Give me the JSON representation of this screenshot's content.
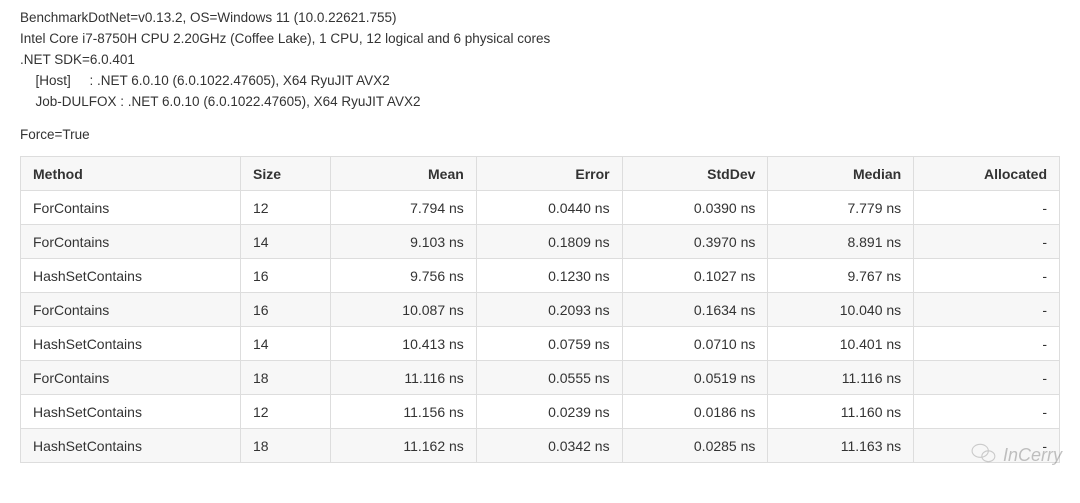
{
  "env": {
    "line1": "BenchmarkDotNet=v0.13.2, OS=Windows 11 (10.0.22621.755)",
    "line2": "Intel Core i7-8750H CPU 2.20GHz (Coffee Lake), 1 CPU, 12 logical and 6 physical cores",
    "line3": ".NET SDK=6.0.401",
    "line4": "  [Host]     : .NET 6.0.10 (6.0.1022.47605), X64 RyuJIT AVX2",
    "line5": "  Job-DULFOX : .NET 6.0.10 (6.0.1022.47605), X64 RyuJIT AVX2"
  },
  "force_line": "Force=True",
  "table": {
    "headers": {
      "method": "Method",
      "size": "Size",
      "mean": "Mean",
      "error": "Error",
      "stddev": "StdDev",
      "median": "Median",
      "allocated": "Allocated"
    },
    "rows": [
      {
        "method": "ForContains",
        "size": "12",
        "mean": "7.794 ns",
        "error": "0.0440 ns",
        "stddev": "0.0390 ns",
        "median": "7.779 ns",
        "allocated": "-"
      },
      {
        "method": "ForContains",
        "size": "14",
        "mean": "9.103 ns",
        "error": "0.1809 ns",
        "stddev": "0.3970 ns",
        "median": "8.891 ns",
        "allocated": "-"
      },
      {
        "method": "HashSetContains",
        "size": "16",
        "mean": "9.756 ns",
        "error": "0.1230 ns",
        "stddev": "0.1027 ns",
        "median": "9.767 ns",
        "allocated": "-"
      },
      {
        "method": "ForContains",
        "size": "16",
        "mean": "10.087 ns",
        "error": "0.2093 ns",
        "stddev": "0.1634 ns",
        "median": "10.040 ns",
        "allocated": "-"
      },
      {
        "method": "HashSetContains",
        "size": "14",
        "mean": "10.413 ns",
        "error": "0.0759 ns",
        "stddev": "0.0710 ns",
        "median": "10.401 ns",
        "allocated": "-"
      },
      {
        "method": "ForContains",
        "size": "18",
        "mean": "11.116 ns",
        "error": "0.0555 ns",
        "stddev": "0.0519 ns",
        "median": "11.116 ns",
        "allocated": "-"
      },
      {
        "method": "HashSetContains",
        "size": "12",
        "mean": "11.156 ns",
        "error": "0.0239 ns",
        "stddev": "0.0186 ns",
        "median": "11.160 ns",
        "allocated": "-"
      },
      {
        "method": "HashSetContains",
        "size": "18",
        "mean": "11.162 ns",
        "error": "0.0342 ns",
        "stddev": "0.0285 ns",
        "median": "11.163 ns",
        "allocated": "-"
      }
    ]
  },
  "watermark": {
    "label": "InCerry"
  }
}
